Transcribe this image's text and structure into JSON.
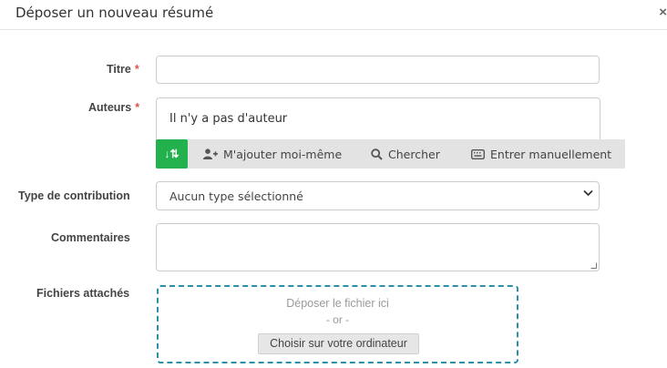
{
  "modal": {
    "title": "Déposer un nouveau résumé",
    "close_symbol": "×"
  },
  "form": {
    "title_label": "Titre",
    "title_value": "",
    "authors_label": "Auteurs",
    "required_mark": "*",
    "authors_empty_text": "Il n'y a pas d'auteur",
    "toolbar": {
      "sort_icon": "sort-icon",
      "sort_symbol": "↓⇅",
      "add_me_icon": "user-plus-icon",
      "add_me_label": "M'ajouter moi-même",
      "search_icon": "search-icon",
      "search_label": "Chercher",
      "manual_icon": "keyboard-icon",
      "manual_label": "Entrer manuellement"
    },
    "contribution_type_label": "Type de contribution",
    "contribution_type_value": "Aucun type sélectionné",
    "comments_label": "Commentaires",
    "comments_value": "",
    "attachments_label": "Fichiers attachés",
    "dropzone": {
      "drop_text": "Déposer le fichier ici",
      "or_text": "- or -",
      "choose_button": "Choisir sur votre ordinateur"
    }
  },
  "colors": {
    "accent_green": "#22b14c",
    "required_red": "#d9534f",
    "dropzone_border": "#2a8fa8"
  }
}
